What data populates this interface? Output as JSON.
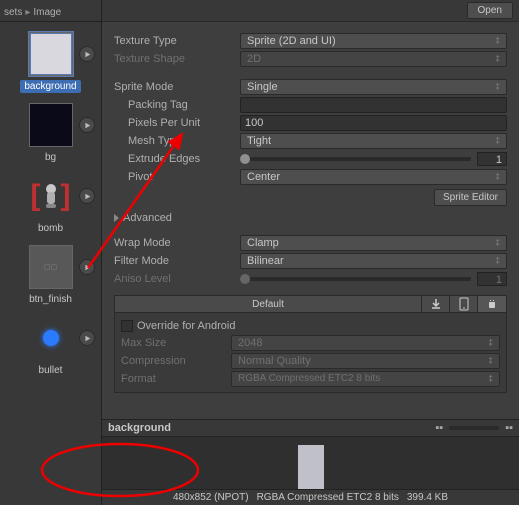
{
  "breadcrumb": {
    "part1": "sets",
    "part2": "Image"
  },
  "topbar": {
    "open": "Open"
  },
  "assets": {
    "background": "background",
    "bg": "bg",
    "bomb": "bomb",
    "btn_finish": "btn_finish",
    "bullet": "bullet"
  },
  "fields": {
    "texture_type_label": "Texture Type",
    "texture_type_value": "Sprite (2D and UI)",
    "texture_shape_label": "Texture Shape",
    "texture_shape_value": "2D",
    "sprite_mode_label": "Sprite Mode",
    "sprite_mode_value": "Single",
    "packing_tag_label": "Packing Tag",
    "packing_tag_value": "",
    "ppu_label": "Pixels Per Unit",
    "ppu_value": "100",
    "mesh_type_label": "Mesh Type",
    "mesh_type_value": "Tight",
    "extrude_label": "Extrude Edges",
    "extrude_value": "1",
    "pivot_label": "Pivot",
    "pivot_value": "Center",
    "advanced": "Advanced",
    "wrap_label": "Wrap Mode",
    "wrap_value": "Clamp",
    "filter_label": "Filter Mode",
    "filter_value": "Bilinear",
    "aniso_label": "Aniso Level",
    "aniso_value": "1"
  },
  "buttons": {
    "sprite_editor": "Sprite Editor"
  },
  "platform": {
    "default_tab": "Default",
    "override": "Override for Android",
    "maxsize_label": "Max Size",
    "maxsize_value": "2048",
    "compression_label": "Compression",
    "compression_value": "Normal Quality",
    "format_label": "Format",
    "format_value": "RGBA Compressed ETC2 8 bits"
  },
  "preview": {
    "title": "background"
  },
  "status": {
    "dims": "480x852 (NPOT)",
    "format": "RGBA Compressed ETC2 8 bits",
    "size": "399.4 KB"
  }
}
